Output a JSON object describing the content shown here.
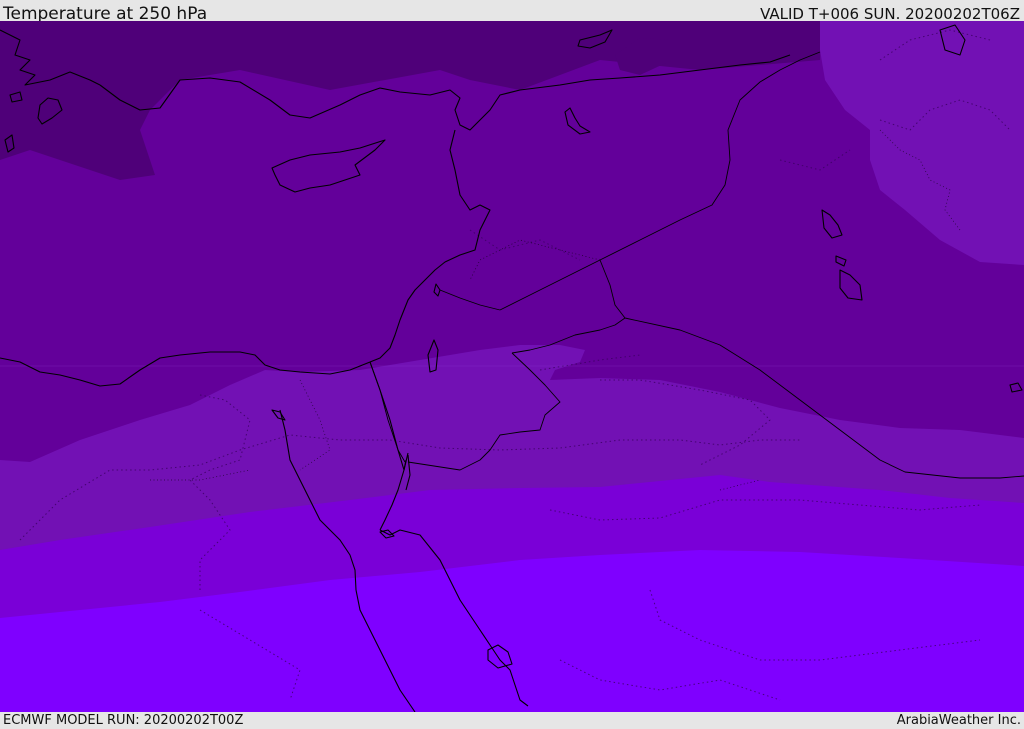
{
  "header": {
    "title": "Temperature at 250 hPa",
    "valid": "VALID T+006 SUN. 20200202T06Z"
  },
  "footer": {
    "model_run": "ECMWF MODEL RUN: 20200202T00Z",
    "credit": "ArabiaWeather Inc."
  },
  "map": {
    "region": "Eastern Mediterranean and Middle East",
    "colors": {
      "band_coldest": "#4f0079",
      "band_cold": "#63009a",
      "band_mid": "#7211b4",
      "band_warm": "#7a00d7",
      "band_warmest": "#7f00ff",
      "coastline": "#000000",
      "borders": "#000000"
    }
  }
}
